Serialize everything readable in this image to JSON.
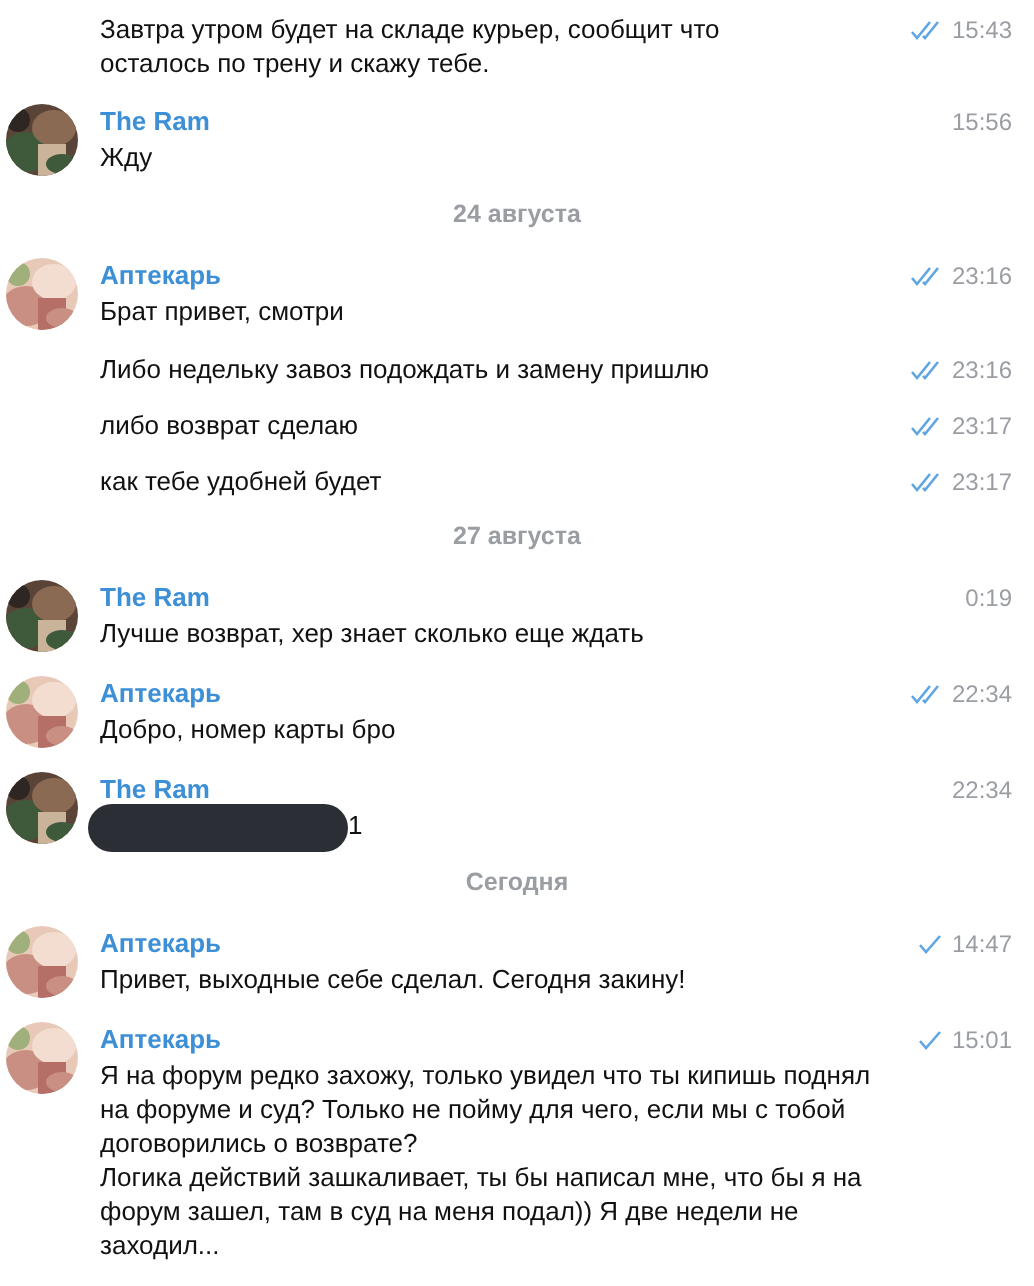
{
  "messages": [
    {
      "kind": "continuation",
      "text": "Завтра утром будет на складе курьер, сообщит что\nосталось по трену и скажу тебе.",
      "time": "15:43",
      "read": true
    },
    {
      "kind": "message",
      "sender": "The Ram",
      "text": "Жду",
      "time": "15:56"
    },
    {
      "kind": "date",
      "text": "24 августа"
    },
    {
      "kind": "message",
      "sender": "Аптекарь",
      "text": "Брат привет, смотри",
      "time": "23:16",
      "read": true
    },
    {
      "kind": "continuation",
      "text": "Либо недельку завоз подождать и замену пришлю",
      "time": "23:16",
      "read": true
    },
    {
      "kind": "continuation",
      "text": "либо возврат сделаю",
      "time": "23:17",
      "read": true
    },
    {
      "kind": "continuation",
      "text": "как тебе удобней будет",
      "time": "23:17",
      "read": true
    },
    {
      "kind": "date",
      "text": "27 августа"
    },
    {
      "kind": "message",
      "sender": "The Ram",
      "text": "Лучше возврат, хер знает сколько еще ждать",
      "time": "0:19"
    },
    {
      "kind": "message",
      "sender": "Аптекарь",
      "text": "Добро, номер карты бро",
      "time": "22:34",
      "read": true
    },
    {
      "kind": "message",
      "sender": "The Ram",
      "text": "1",
      "redacted": true,
      "time": "22:34"
    },
    {
      "kind": "date",
      "text": "Сегодня"
    },
    {
      "kind": "message",
      "sender": "Аптекарь",
      "text": "Привет, выходные себе сделал. Сегодня закину!",
      "time": "14:47",
      "read": false
    },
    {
      "kind": "message",
      "sender": "Аптекарь",
      "text": "Я на форум редко захожу, только увидел что ты кипишь поднял\nна форуме и суд? Только не пойму для чего, если мы с тобой\nдоговорились о возврате?\nЛогика действий зашкаливает, ты бы написал мне, что бы я на\nфорум зашел, там в суд на меня подал)) Я две недели не\nзаходил...",
      "time": "15:01",
      "read": false
    }
  ]
}
